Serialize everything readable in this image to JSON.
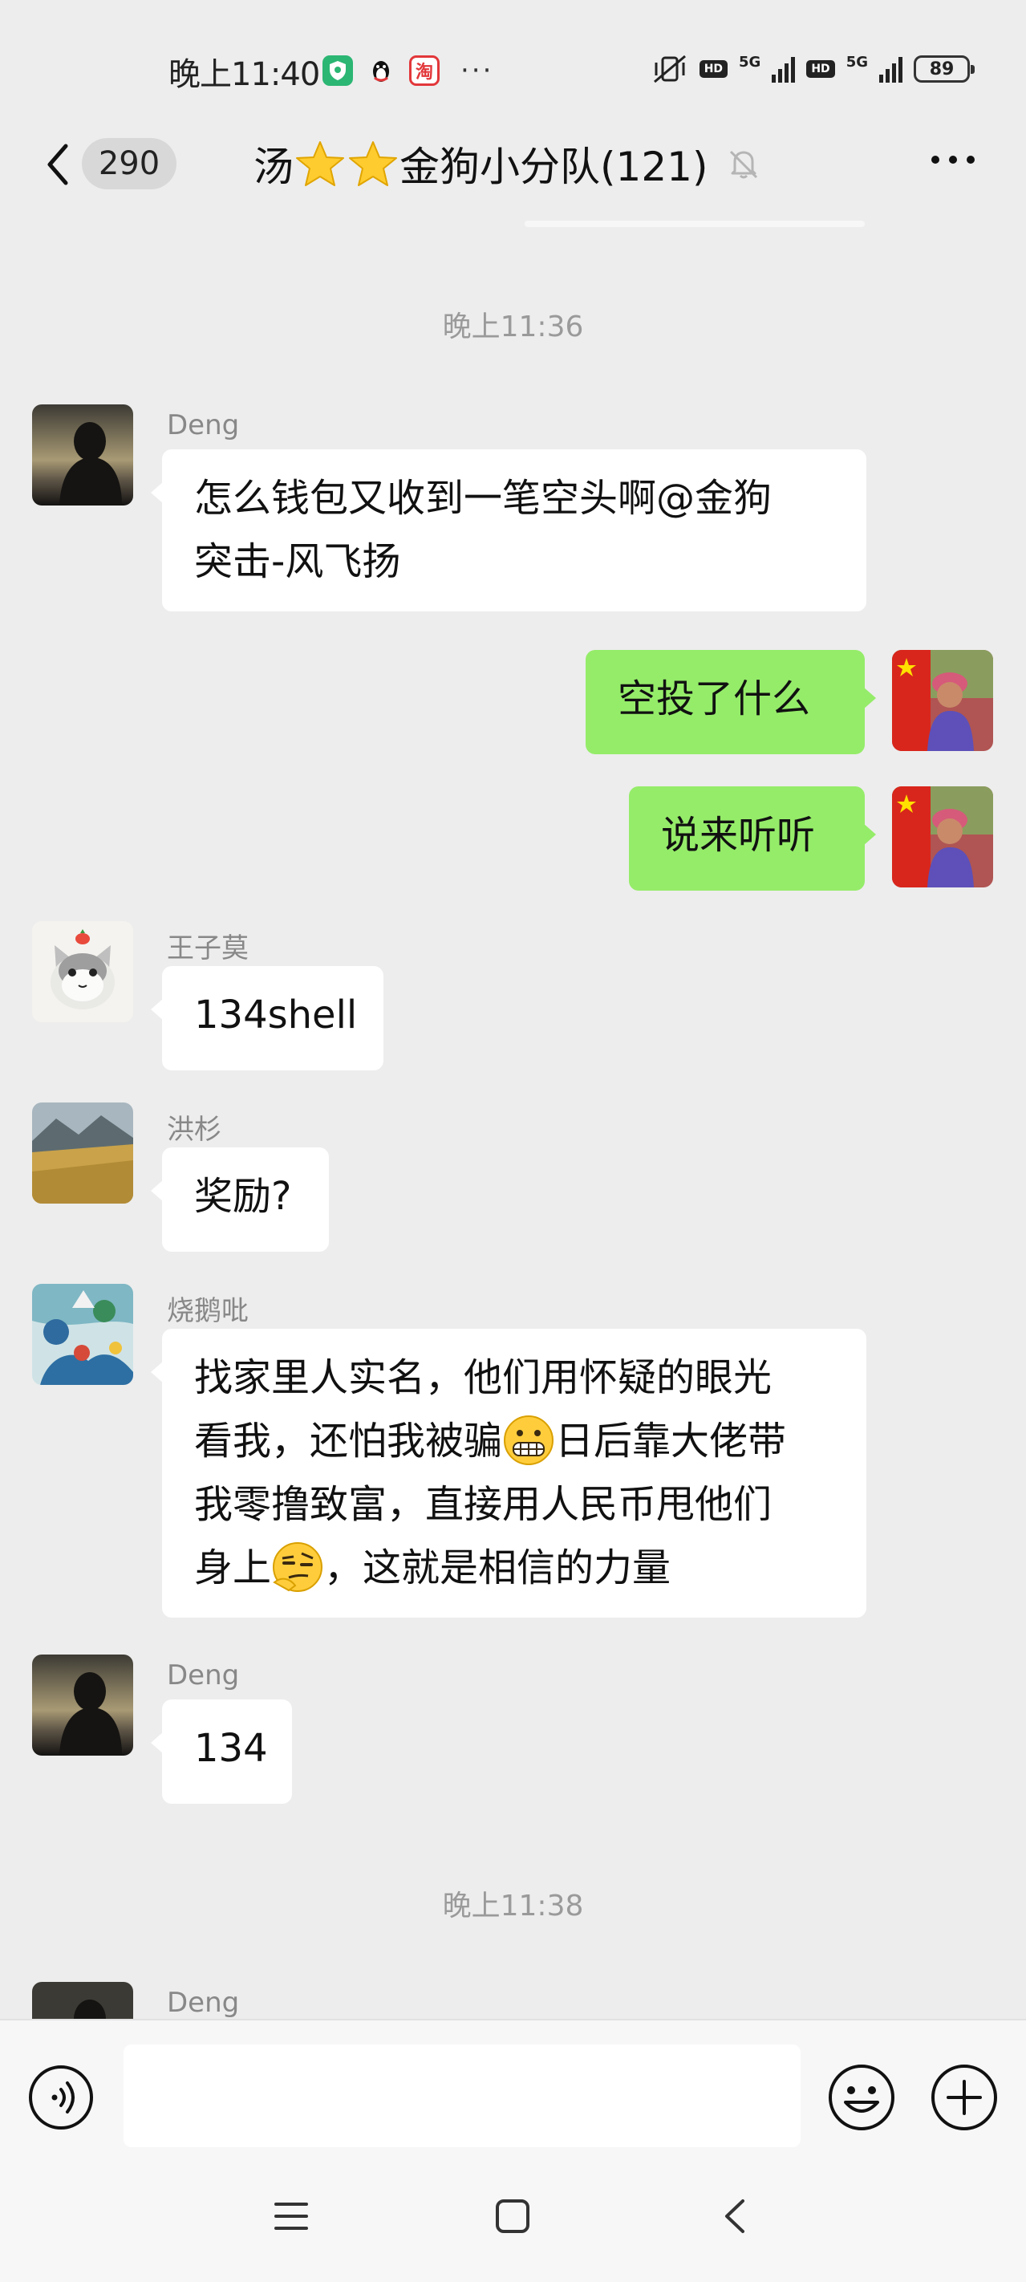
{
  "status_bar": {
    "time": "晚上11:40",
    "apps": {
      "taobao": "淘"
    },
    "network": [
      "5G",
      "5G"
    ],
    "hd": [
      "HD",
      "HD"
    ],
    "battery": "89"
  },
  "nav": {
    "unread_count": "290",
    "title_prefix": "汤",
    "title_suffix": "金狗小分队(121)"
  },
  "messages": {
    "time_1": "晚上11:36",
    "time_2": "晚上11:38",
    "m1": {
      "sender": "Deng",
      "line1": "怎么钱包又收到一笔空头啊@金狗",
      "line2": "突击-风飞扬"
    },
    "m2": {
      "text": "空投了什么"
    },
    "m3": {
      "text": "说来听听"
    },
    "m4": {
      "sender": "王子莫",
      "text": "134shell"
    },
    "m5": {
      "sender": "洪杉",
      "text": "奖励?"
    },
    "m6": {
      "sender": "烧鹅吡",
      "line1": "找家里人实名，他们用怀疑的眼光",
      "line2a": "看我，还怕我被骗",
      "line2b": "日后靠大佬带",
      "line3": "我零撸致富，直接用人民币甩他们",
      "line4a": "身上",
      "line4b": "，这就是相信的力量"
    },
    "m7": {
      "sender": "Deng",
      "text": "134"
    },
    "m8": {
      "sender": "Deng"
    }
  },
  "input": {
    "value": ""
  },
  "colors": {
    "background": "#ededed",
    "bubble_me": "#95ec69",
    "bubble_other": "#ffffff"
  }
}
